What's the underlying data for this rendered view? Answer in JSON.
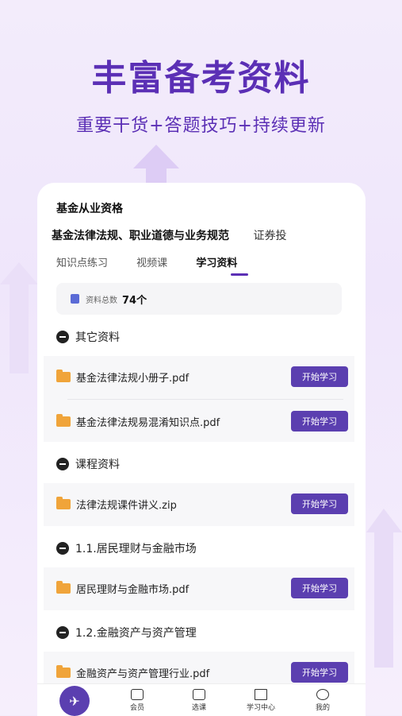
{
  "headline": "丰富备考资料",
  "subline": "重要干货+答题技巧+持续更新",
  "category": "基金从业资格",
  "subjects": [
    "基金法律法规、职业道德与业务规范",
    "证券投"
  ],
  "tabs": [
    "知识点练习",
    "视频课",
    "学习资料"
  ],
  "total": {
    "label": "资料总数",
    "value": "74个"
  },
  "sections": [
    {
      "title": "其它资料",
      "files": [
        "基金法律法规小册子.pdf",
        "基金法律法规易混淆知识点.pdf"
      ]
    },
    {
      "title": "课程资料",
      "files": [
        "法律法规课件讲义.zip"
      ]
    },
    {
      "title": "1.1.居民理财与金融市场",
      "files": [
        "居民理财与金融市场.pdf"
      ]
    },
    {
      "title": "1.2.金融资产与资产管理",
      "files": [
        "金融资产与资产管理行业.pdf"
      ]
    }
  ],
  "start_label": "开始学习",
  "nav": [
    "会员",
    "选课",
    "学习中心",
    "我的"
  ],
  "colors": {
    "accent": "#5b3fb0",
    "headline": "#5b2fb5",
    "folder": "#f0a43a"
  }
}
